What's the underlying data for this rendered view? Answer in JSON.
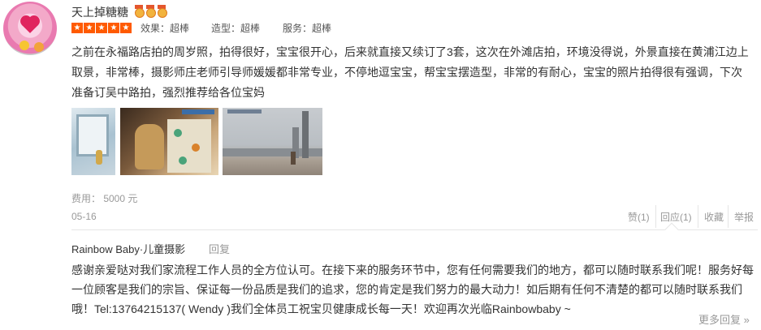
{
  "user": {
    "name": "天上掉糖糖",
    "medal_count": 3,
    "rating_stars": 5,
    "scores": [
      {
        "label": "效果：超棒"
      },
      {
        "label": "造型：超棒"
      },
      {
        "label": "服务：超棒"
      }
    ]
  },
  "review": {
    "content": "之前在永福路店拍的周岁照，拍得很好，宝宝很开心，后来就直接又续订了3套，这次在外滩店拍，环境没得说，外景直接在黄浦江边上取景，非常棒，摄影师庄老师引导师媛媛都非常专业，不停地逗宝宝，帮宝宝摆造型，非常的有耐心，宝宝的照片拍得很有强调，下次准备订吴中路拍，强烈推荐给各位宝妈",
    "fee": "费用：  5000 元",
    "date": "05-16"
  },
  "actions": {
    "like": "赞(1)",
    "reply": "回应(1)",
    "favorite": "收藏",
    "report": "举报"
  },
  "merchant_reply": {
    "name": "Rainbow Baby·儿童摄影",
    "label": "回复",
    "text": "感谢亲爱哒对我们家流程工作人员的全方位认可。在接下来的服务环节中，您有任何需要我们的地方，都可以随时联系我们呢！服务好每一位顾客是我们的宗旨、保证每一份品质是我们的追求，您的肯定是我们努力的最大动力！如后期有任何不清楚的都可以随时联系我们哦！Tel:13764215137( Wendy )我们全体员工祝宝贝健康成长每一天！欢迎再次光临Rainbowbaby ~",
    "more": "更多回复 »"
  },
  "colors": {
    "star": "#ff5a00",
    "muted": "#999999",
    "text": "#333333"
  }
}
